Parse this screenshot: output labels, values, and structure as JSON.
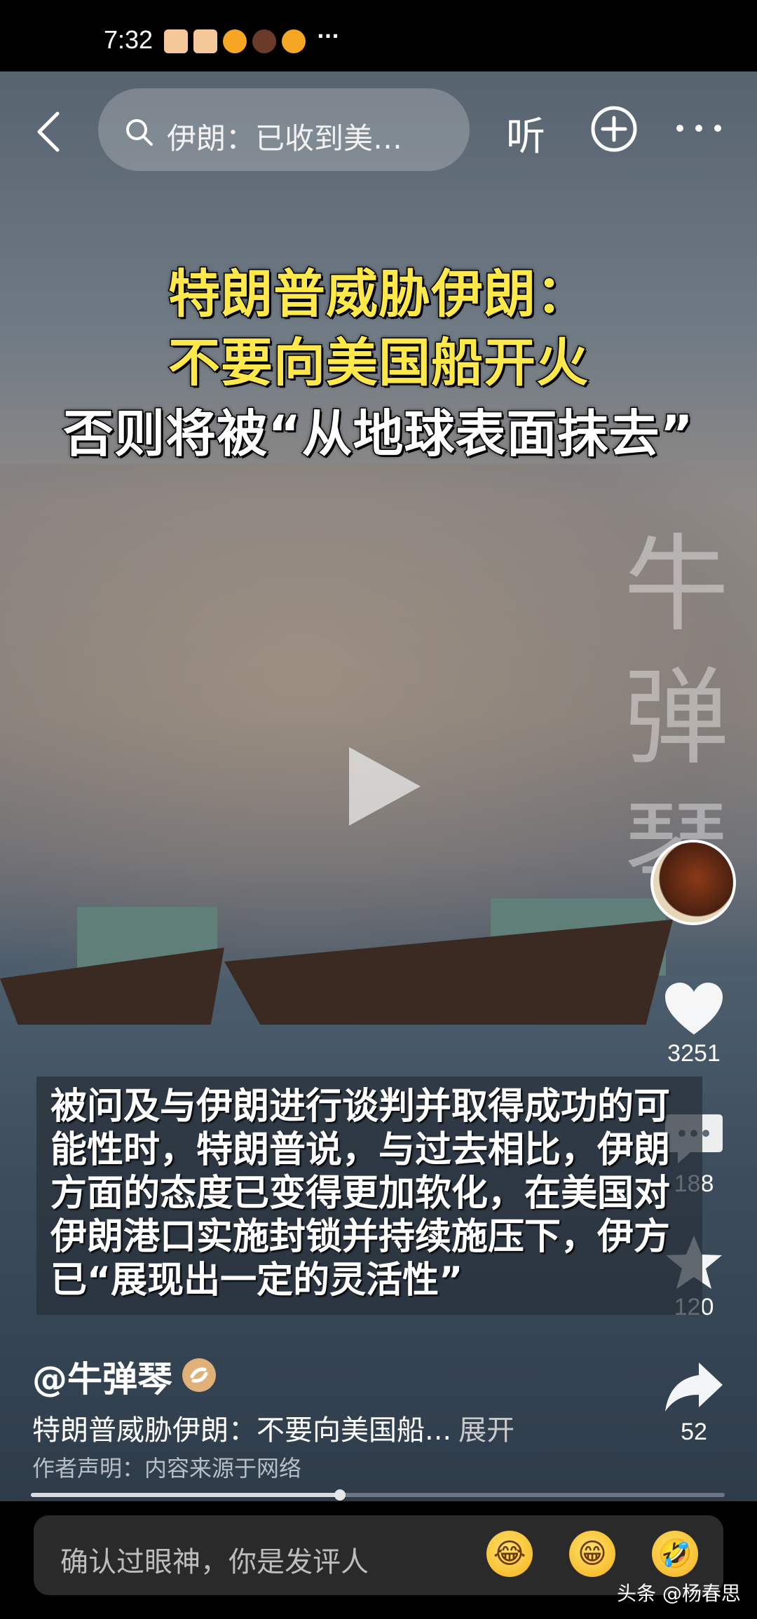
{
  "status_bar": {
    "time": "7:32",
    "more": "···"
  },
  "search": {
    "text": "伊朗：已收到美…"
  },
  "top_actions": {
    "listen": "听"
  },
  "video": {
    "headline_lines": [
      "特朗普威胁伊朗：",
      "不要向美国船开火",
      "否则将被“从地球表面抹去”"
    ],
    "watermark": "牛弹琴",
    "caption": "被问及与伊朗进行谈判并取得成功的可能性时，特朗普说，与过去相比，伊朗方面的态度已变得更加软化，在美国对伊朗港口实施封锁并持续施压下，伊方已“展现出一定的灵活性”"
  },
  "side_actions": {
    "likes": "3251",
    "comments": "188",
    "favorites": "120",
    "shares": "52"
  },
  "post": {
    "author": "@牛弹琴",
    "description": "特朗普威胁伊朗：不要向美国船...",
    "expand_label": "展开",
    "declaration": "作者声明：内容来源于网络"
  },
  "progress": {
    "fraction": 0.445
  },
  "comment": {
    "placeholder": "确认过眼神，你是发评人"
  },
  "attribution": "头条 @杨春思",
  "colors": {
    "headline_yellow": "#ffe84a",
    "verified": "#e0b27a"
  }
}
